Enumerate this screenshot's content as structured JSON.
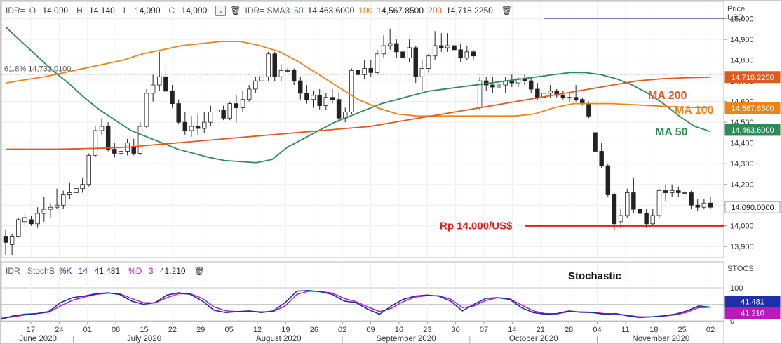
{
  "legend_main": {
    "symbol": "IDR=",
    "o_label": "O",
    "o_value": "14,090",
    "h_label": "H",
    "h_value": "14,140",
    "l_label": "L",
    "l_value": "14,090",
    "c_label": "C",
    "c_value": "14,090",
    "sma_label": "IDR= SMA3",
    "p50": "50",
    "v50": "14,463.6000",
    "p100": "100",
    "v100": "14,567.8500",
    "p200": "200",
    "v200": "14,718.2250"
  },
  "legend_stoch": {
    "label": "IDR= StochS",
    "k_label": "%K",
    "k_period": "14",
    "k_value": "41.481",
    "d_label": "%D",
    "d_period": "3",
    "d_value": "41.210"
  },
  "axis_main_title": [
    "Price",
    "USD"
  ],
  "axis_stoch_title": "STOCS",
  "price_ticks": [
    "15,000",
    "14,900",
    "14,800",
    "14,700",
    "14,600",
    "14,500",
    "14,400",
    "14,300",
    "14,200",
    "14,100",
    "14,000",
    "13,900"
  ],
  "fib_label": "61.8%  14,732.0100",
  "stoch_ticks": [
    "100",
    "50",
    "0"
  ],
  "day_labels": [
    "17",
    "24",
    "01",
    "08",
    "15",
    "22",
    "29",
    "05",
    "12",
    "19",
    "26",
    "02",
    "09",
    "16",
    "23",
    "30",
    "07",
    "14",
    "21",
    "28",
    "04",
    "11",
    "18",
    "25",
    "02"
  ],
  "month_labels": [
    "June 2020",
    "July 2020",
    "August 2020",
    "September 2020",
    "October 2020",
    "November 2020"
  ],
  "annotations": {
    "ma200": "MA 200",
    "ma100": "MA 100",
    "ma50": "MA 50",
    "support": "Rp 14.000/US$",
    "stoch": "Stochastic"
  },
  "price_badges": {
    "ma200": "14,718.2250",
    "ma100": "14,567.8500",
    "ma50": "14,463.6000",
    "last": "14,090.0000"
  },
  "stoch_badges": {
    "k": "41.481",
    "d": "41.210"
  },
  "colors": {
    "ma50": "#2e8b57",
    "ma100": "#e8841a",
    "ma200": "#e05a1e",
    "support": "#e02020",
    "k": "#1f2fa8",
    "d": "#b81bb8",
    "fib": "#3b4aa0"
  },
  "chart_data": [
    {
      "type": "candlestick",
      "interval": "daily",
      "x_start": "2020-06-11",
      "x_end": "2020-11-03",
      "ylim": [
        13850,
        15080
      ],
      "reference_lines": [
        {
          "name": "61.8%",
          "value": 14732.01
        },
        {
          "name": "Rp 14.000/US$",
          "value": 14000
        }
      ],
      "candles": [
        [
          13950,
          13980,
          13860,
          13920
        ],
        [
          13910,
          13960,
          13860,
          13950
        ],
        [
          13950,
          14040,
          13950,
          14030
        ],
        [
          14020,
          14060,
          14000,
          14040
        ],
        [
          14030,
          14050,
          14000,
          14010
        ],
        [
          14010,
          14090,
          13990,
          14060
        ],
        [
          14060,
          14140,
          14020,
          14080
        ],
        [
          14080,
          14110,
          14040,
          14090
        ],
        [
          14090,
          14180,
          14080,
          14100
        ],
        [
          14100,
          14170,
          14080,
          14150
        ],
        [
          14150,
          14210,
          14130,
          14160
        ],
        [
          14160,
          14220,
          14130,
          14180
        ],
        [
          14180,
          14230,
          14160,
          14200
        ],
        [
          14200,
          14350,
          14190,
          14340
        ],
        [
          14340,
          14480,
          14330,
          14460
        ],
        [
          14460,
          14520,
          14440,
          14480
        ],
        [
          14480,
          14500,
          14360,
          14370
        ],
        [
          14370,
          14400,
          14330,
          14350
        ],
        [
          14350,
          14390,
          14320,
          14360
        ],
        [
          14360,
          14420,
          14340,
          14400
        ],
        [
          14380,
          14420,
          14340,
          14350
        ],
        [
          14350,
          14500,
          14340,
          14480
        ],
        [
          14480,
          14660,
          14470,
          14640
        ],
        [
          14640,
          14730,
          14600,
          14680
        ],
        [
          14680,
          14840,
          14650,
          14720
        ],
        [
          14720,
          14770,
          14640,
          14650
        ],
        [
          14650,
          14680,
          14570,
          14590
        ],
        [
          14590,
          14610,
          14490,
          14500
        ],
        [
          14500,
          14550,
          14440,
          14460
        ],
        [
          14460,
          14530,
          14430,
          14480
        ],
        [
          14480,
          14540,
          14440,
          14470
        ],
        [
          14470,
          14550,
          14450,
          14500
        ],
        [
          14500,
          14580,
          14480,
          14550
        ],
        [
          14550,
          14600,
          14530,
          14560
        ],
        [
          14560,
          14580,
          14510,
          14520
        ],
        [
          14520,
          14600,
          14510,
          14590
        ],
        [
          14590,
          14630,
          14500,
          14570
        ],
        [
          14570,
          14650,
          14550,
          14610
        ],
        [
          14610,
          14680,
          14600,
          14660
        ],
        [
          14660,
          14720,
          14640,
          14700
        ],
        [
          14700,
          14760,
          14680,
          14720
        ],
        [
          14720,
          14840,
          14700,
          14830
        ],
        [
          14830,
          14840,
          14700,
          14720
        ],
        [
          14720,
          14780,
          14700,
          14750
        ],
        [
          14750,
          14760,
          14740,
          14750
        ],
        [
          14750,
          14760,
          14680,
          14700
        ],
        [
          14700,
          14720,
          14610,
          14640
        ],
        [
          14640,
          14680,
          14590,
          14610
        ],
        [
          14610,
          14650,
          14570,
          14630
        ],
        [
          14630,
          14660,
          14560,
          14580
        ],
        [
          14580,
          14640,
          14560,
          14620
        ],
        [
          14620,
          14660,
          14590,
          14610
        ],
        [
          14610,
          14640,
          14500,
          14520
        ],
        [
          14520,
          14570,
          14500,
          14550
        ],
        [
          14550,
          14760,
          14540,
          14750
        ],
        [
          14750,
          14790,
          14700,
          14730
        ],
        [
          14730,
          14800,
          14710,
          14760
        ],
        [
          14760,
          14800,
          14720,
          14740
        ],
        [
          14740,
          14850,
          14730,
          14830
        ],
        [
          14830,
          14920,
          14810,
          14870
        ],
        [
          14870,
          14950,
          14850,
          14880
        ],
        [
          14880,
          14900,
          14810,
          14840
        ],
        [
          14840,
          14860,
          14800,
          14810
        ],
        [
          14810,
          14900,
          14790,
          14860
        ],
        [
          14860,
          14870,
          14690,
          14720
        ],
        [
          14720,
          14800,
          14650,
          14760
        ],
        [
          14760,
          14830,
          14740,
          14820
        ],
        [
          14820,
          14940,
          14800,
          14870
        ],
        [
          14870,
          14930,
          14840,
          14860
        ],
        [
          14860,
          14930,
          14840,
          14870
        ],
        [
          14870,
          14900,
          14840,
          14850
        ],
        [
          14850,
          14880,
          14790,
          14810
        ],
        [
          14810,
          14870,
          14800,
          14840
        ],
        [
          14840,
          14850,
          14800,
          14820
        ],
        [
          14570,
          14720,
          14560,
          14700
        ],
        [
          14700,
          14720,
          14650,
          14680
        ],
        [
          14680,
          14720,
          14640,
          14670
        ],
        [
          14670,
          14700,
          14650,
          14680
        ],
        [
          14680,
          14720,
          14640,
          14700
        ],
        [
          14700,
          14730,
          14670,
          14690
        ],
        [
          14690,
          14720,
          14670,
          14710
        ],
        [
          14710,
          14730,
          14680,
          14700
        ],
        [
          14700,
          14720,
          14640,
          14660
        ],
        [
          14660,
          14690,
          14610,
          14620
        ],
        [
          14620,
          14660,
          14600,
          14640
        ],
        [
          14640,
          14680,
          14620,
          14650
        ],
        [
          14650,
          14660,
          14620,
          14630
        ],
        [
          14630,
          14650,
          14610,
          14620
        ],
        [
          14620,
          14640,
          14600,
          14620
        ],
        [
          14620,
          14680,
          14600,
          14610
        ],
        [
          14610,
          14620,
          14580,
          14590
        ],
        [
          14590,
          14600,
          14520,
          14530
        ],
        [
          14450,
          14460,
          14350,
          14360
        ],
        [
          14360,
          14400,
          14280,
          14290
        ],
        [
          14290,
          14300,
          14140,
          14150
        ],
        [
          14150,
          14160,
          13980,
          14010
        ],
        [
          14020,
          14080,
          13990,
          14050
        ],
        [
          14050,
          14180,
          14040,
          14160
        ],
        [
          14160,
          14230,
          14060,
          14080
        ],
        [
          14080,
          14100,
          14020,
          14060
        ],
        [
          14060,
          14080,
          13990,
          14010
        ],
        [
          14010,
          14080,
          14000,
          14050
        ],
        [
          14050,
          14180,
          14040,
          14170
        ],
        [
          14170,
          14200,
          14120,
          14160
        ],
        [
          14160,
          14200,
          14140,
          14170
        ],
        [
          14170,
          14190,
          14140,
          14160
        ],
        [
          14160,
          14180,
          14140,
          14160
        ],
        [
          14160,
          14170,
          14080,
          14100
        ],
        [
          14100,
          14130,
          14070,
          14090
        ],
        [
          14090,
          14130,
          14080,
          14110
        ],
        [
          14110,
          14140,
          14080,
          14090
        ]
      ]
    },
    {
      "type": "line",
      "series": [
        {
          "name": "MA 50",
          "values": [
            14960,
            14890,
            14820,
            14750,
            14690,
            14620,
            14560,
            14510,
            14460,
            14430,
            14400,
            14370,
            14350,
            14330,
            14315,
            14310,
            14305,
            14320,
            14380,
            14420,
            14460,
            14500,
            14530,
            14560,
            14590,
            14610,
            14630,
            14650,
            14660,
            14670,
            14680,
            14690,
            14700,
            14710,
            14720,
            14730,
            14740,
            14740,
            14730,
            14710,
            14680,
            14640,
            14590,
            14530,
            14480,
            14455
          ]
        },
        {
          "name": "MA 100",
          "values": [
            14690,
            14705,
            14720,
            14740,
            14760,
            14780,
            14800,
            14830,
            14850,
            14870,
            14880,
            14890,
            14890,
            14870,
            14840,
            14790,
            14730,
            14670,
            14610,
            14570,
            14540,
            14530,
            14530,
            14530,
            14530,
            14530,
            14530,
            14540,
            14570,
            14590,
            14590,
            14590,
            14585,
            14580,
            14575,
            14572,
            14570
          ]
        },
        {
          "name": "MA 200",
          "values": [
            14370,
            14370,
            14370,
            14372,
            14375,
            14380,
            14390,
            14400,
            14410,
            14420,
            14430,
            14440,
            14450,
            14460,
            14470,
            14480,
            14500,
            14520,
            14540,
            14560,
            14580,
            14600,
            14620,
            14640,
            14660,
            14680,
            14700,
            14710,
            14715,
            14718
          ]
        }
      ]
    },
    {
      "type": "line",
      "title": "Stochastic",
      "ylim": [
        0,
        100
      ],
      "series": [
        {
          "name": "%K",
          "values": [
            5,
            15,
            20,
            22,
            28,
            55,
            70,
            75,
            82,
            85,
            80,
            60,
            50,
            55,
            78,
            85,
            80,
            60,
            32,
            25,
            28,
            30,
            25,
            30,
            55,
            90,
            92,
            88,
            80,
            60,
            55,
            35,
            20,
            45,
            65,
            75,
            78,
            75,
            60,
            30,
            50,
            68,
            70,
            65,
            40,
            25,
            20,
            22,
            30,
            26,
            25,
            20,
            22,
            15,
            10,
            12,
            15,
            20,
            30,
            45,
            41
          ]
        },
        {
          "name": "%D",
          "values": [
            8,
            12,
            18,
            22,
            26,
            45,
            62,
            72,
            80,
            84,
            82,
            68,
            55,
            54,
            70,
            82,
            82,
            68,
            42,
            30,
            28,
            29,
            27,
            28,
            45,
            80,
            90,
            89,
            84,
            68,
            58,
            42,
            28,
            38,
            58,
            72,
            76,
            76,
            66,
            40,
            45,
            62,
            70,
            67,
            48,
            30,
            22,
            21,
            28,
            27,
            26,
            22,
            21,
            17,
            12,
            12,
            14,
            18,
            26,
            40,
            41
          ]
        }
      ]
    }
  ]
}
